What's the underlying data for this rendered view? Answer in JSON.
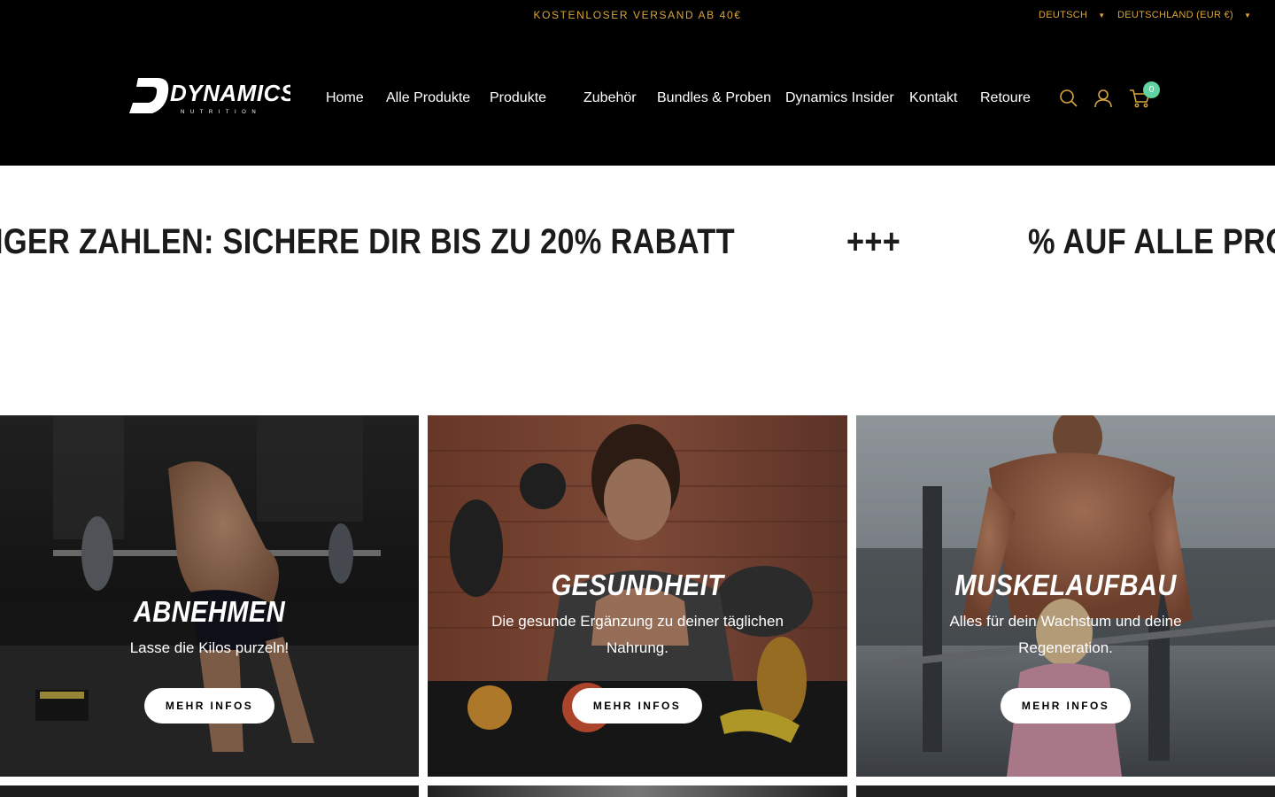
{
  "topbar": {
    "promo": "KOSTENLOSER VERSAND AB 40€",
    "language": "DEUTSCH",
    "country": "DEUTSCHLAND (EUR €)"
  },
  "header": {
    "logo_text": "DYNAMICS",
    "logo_subtext": "NUTRITION",
    "nav": [
      "Home",
      "Alle Produkte",
      "Produkte",
      "Zubehör",
      "Bundles & Proben",
      "Dynamics Insider",
      "Kontakt",
      "Retoure"
    ],
    "cart_count": "0"
  },
  "marquee": {
    "segment_1": "IGER ZAHLEN: SICHERE DIR BIS ZU 20% RABATT",
    "separator": "+++",
    "segment_2": "% AUF ALLE PRO"
  },
  "tiles": [
    {
      "title": "ABNEHMEN",
      "subtitle": "Lasse die Kilos purzeln!",
      "button": "MEHR INFOS"
    },
    {
      "title": "GESUNDHEIT",
      "subtitle": "Die gesunde Ergänzung zu deiner täglichen Nahrung.",
      "button": "MEHR INFOS"
    },
    {
      "title": "MUSKELAUFBAU",
      "subtitle": "Alles für dein Wachstum und deine Regeneration.",
      "button": "MEHR INFOS"
    }
  ],
  "colors": {
    "topbar_text": "#d9a53a",
    "cart_badge": "#5fd3a0",
    "header_bg": "#000000",
    "icon_accent": "#d9a53a"
  }
}
